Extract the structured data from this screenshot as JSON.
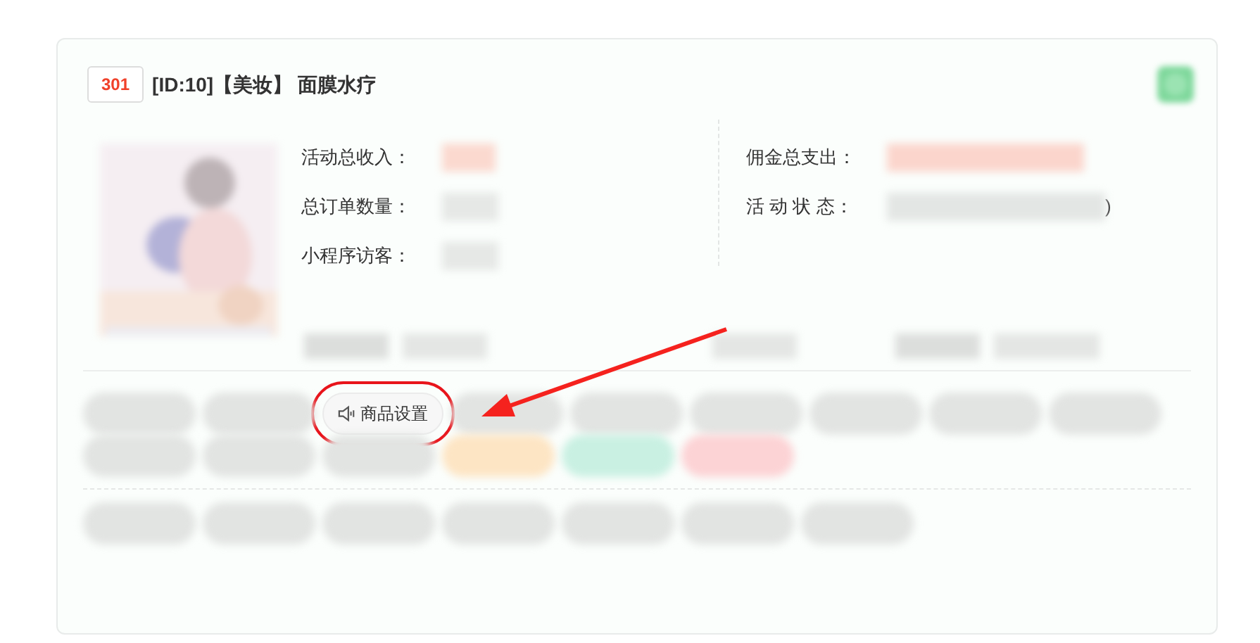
{
  "card": {
    "badge": "301",
    "title": "[ID:10]【美妆】 面膜水疗"
  },
  "stats_left": [
    {
      "label": "活动总收入：",
      "color": "#fbd9cf"
    },
    {
      "label": "总订单数量：",
      "color": "#e6e8e6"
    },
    {
      "label": "小程序访客：",
      "color": "#e6e8e6"
    }
  ],
  "stats_right": [
    {
      "label": "佣金总支出：",
      "color": "#fbd5cc"
    },
    {
      "label": "活 动 状 态：",
      "color": "#e3e6e4",
      "suffix": ")"
    }
  ],
  "action_rows": [
    [
      {
        "kind": "redacted",
        "color": "#e2e4e2"
      },
      {
        "kind": "redacted",
        "color": "#e2e4e2"
      },
      {
        "kind": "button",
        "label": "商品设置",
        "highlighted": true
      },
      {
        "kind": "redacted",
        "color": "#e2e4e2"
      },
      {
        "kind": "redacted",
        "color": "#e2e4e2"
      },
      {
        "kind": "redacted",
        "color": "#e2e4e2"
      },
      {
        "kind": "redacted",
        "color": "#e2e4e2"
      },
      {
        "kind": "redacted",
        "color": "#e2e4e2"
      },
      {
        "kind": "redacted",
        "color": "#e2e4e2"
      }
    ],
    [
      {
        "kind": "redacted",
        "color": "#e2e4e2"
      },
      {
        "kind": "redacted",
        "color": "#e2e4e2"
      },
      {
        "kind": "redacted",
        "color": "#e2e4e2"
      },
      {
        "kind": "redacted",
        "color": "#fde5c4"
      },
      {
        "kind": "redacted",
        "color": "#c9f0e2"
      },
      {
        "kind": "redacted",
        "color": "#fcd3d5"
      }
    ],
    [
      {
        "kind": "redacted",
        "color": "#e2e4e2"
      },
      {
        "kind": "redacted",
        "color": "#e2e4e2"
      },
      {
        "kind": "redacted",
        "color": "#e2e4e2"
      },
      {
        "kind": "redacted",
        "color": "#e2e4e2"
      },
      {
        "kind": "redacted",
        "color": "#e2e4e2"
      },
      {
        "kind": "redacted",
        "color": "#e2e4e2"
      },
      {
        "kind": "redacted",
        "color": "#e2e4e2"
      }
    ]
  ]
}
